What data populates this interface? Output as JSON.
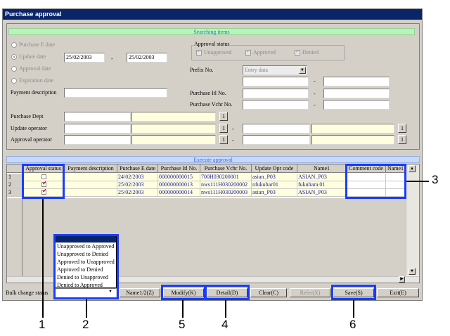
{
  "window": {
    "title": "Purchase approval"
  },
  "search": {
    "banner": "Searching items",
    "date_options": [
      {
        "label": "Purchase E date",
        "selected": false
      },
      {
        "label": "Update date",
        "selected": true
      },
      {
        "label": "Approval date",
        "selected": false
      },
      {
        "label": "Expiration date",
        "selected": false
      }
    ],
    "date_from": "25/02/2003",
    "date_sep": "-",
    "date_to": "25/02/2003",
    "approval_status": {
      "title": "Approval status",
      "options": [
        "Unapproved",
        "Approved",
        "Denied"
      ]
    },
    "prefix_no": {
      "label": "Prefix No.",
      "value": "Entry data"
    },
    "payment_description": {
      "label": "Payment description"
    },
    "purchase_itl_no": {
      "label": "Purchase Itl No."
    },
    "purchase_vchr_no": {
      "label": "Purchase Vchr No."
    },
    "purchase_dept": {
      "label": "Purchase Dept"
    },
    "update_operator": {
      "label": "Update operator"
    },
    "approval_operator": {
      "label": "Approval operator"
    },
    "lookup_label": "1",
    "range_sep": "-"
  },
  "grid": {
    "banner": "Execute approval",
    "columns": [
      "Approval status",
      "Payment description",
      "Purchase E date",
      "Purchase Itl No.",
      "Purchase Vchr No.",
      "Update Opr code",
      "Name1",
      "Comment code",
      "Name1"
    ],
    "rows": [
      {
        "num": "1",
        "checked": false,
        "payment": "",
        "e_date": "24/02/2003",
        "itl_no": "000000000015",
        "vchr_no": "700H030200001",
        "opr_code": "asian_P03",
        "name1": "ASIAN_P03",
        "comment": "",
        "name1b": ""
      },
      {
        "num": "2",
        "checked": true,
        "payment": "",
        "e_date": "25/02/2003",
        "itl_no": "000000000013",
        "vchr_no": "nws111H030200002",
        "opr_code": "nfukuhar01",
        "name1": "fukuhara 01",
        "comment": "",
        "name1b": ""
      },
      {
        "num": "3",
        "checked": true,
        "payment": "",
        "e_date": "25/02/2003",
        "itl_no": "000000000014",
        "vchr_no": "nws111H030200003",
        "opr_code": "asian_P03",
        "name1": "ASIAN_P03",
        "comment": "",
        "name1b": ""
      }
    ]
  },
  "bulk": {
    "label": "Bulk change status",
    "options": [
      "Unapproved to Approved",
      "Unapproved to Denied",
      "Approved to Unapproved",
      "Approved to Denied",
      "Denied to Unapproved",
      "Denied to Approved"
    ]
  },
  "buttons": {
    "name1_2": "Name1/2(Z)",
    "modify": "Modify(K)",
    "detail": "Detail(D)",
    "clear": "Clear(C)",
    "refer": "Refer(X)",
    "save": "Save(S)",
    "exit": "Exit(E)"
  },
  "callouts": [
    "1",
    "2",
    "5",
    "4",
    "6",
    "3"
  ],
  "colors": {
    "title_bar": "#0a246a",
    "highlight": "#1a3cff",
    "banner_green": "#b8f4b8",
    "field_yellow": "#ffffe0"
  }
}
